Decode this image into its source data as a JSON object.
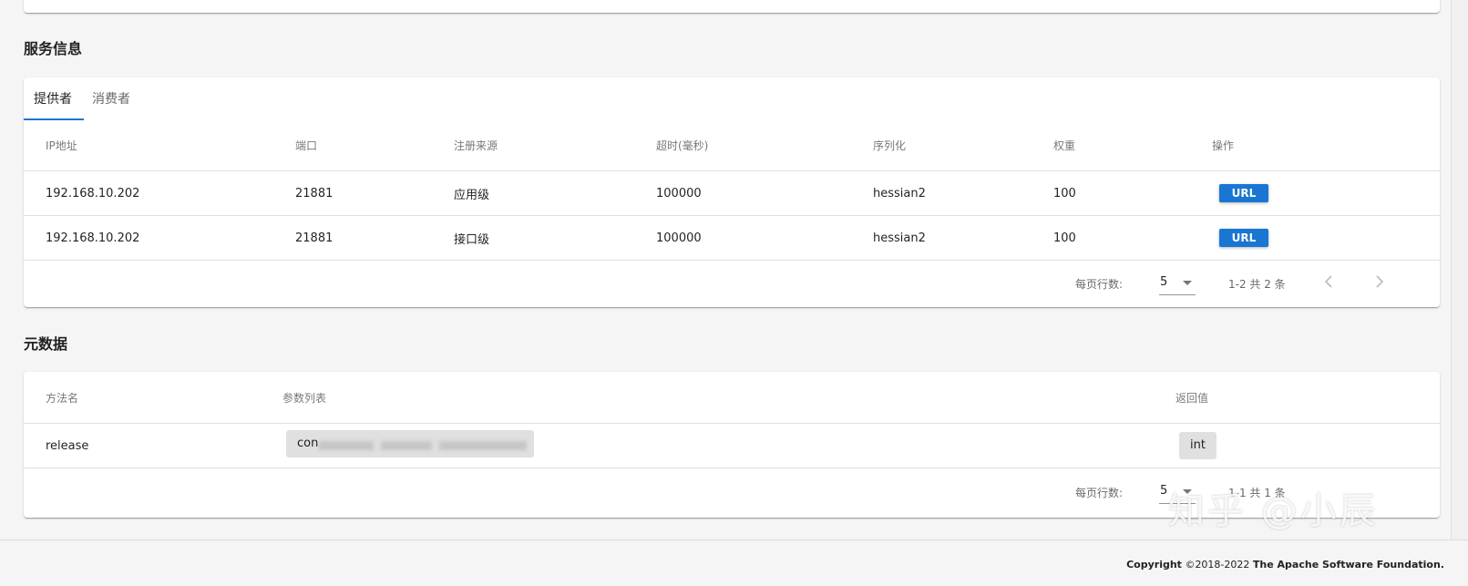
{
  "service_section": {
    "title": "服务信息",
    "tabs": [
      {
        "label": "提供者",
        "active": true
      },
      {
        "label": "消费者",
        "active": false
      }
    ],
    "columns": [
      "IP地址",
      "端口",
      "注册来源",
      "超时(毫秒)",
      "序列化",
      "权重",
      "操作"
    ],
    "rows": [
      {
        "ip": "192.168.10.202",
        "port": "21881",
        "source": "应用级",
        "timeout": "100000",
        "serialization": "hessian2",
        "weight": "100",
        "action": "URL"
      },
      {
        "ip": "192.168.10.202",
        "port": "21881",
        "source": "接口级",
        "timeout": "100000",
        "serialization": "hessian2",
        "weight": "100",
        "action": "URL"
      }
    ],
    "pagination": {
      "rows_per_page_label": "每页行数:",
      "rows_per_page": "5",
      "range": "1-2 共 2 条"
    }
  },
  "metadata_section": {
    "title": "元数据",
    "columns": [
      "方法名",
      "参数列表",
      "返回值"
    ],
    "rows": [
      {
        "method": "release",
        "params": "con",
        "return": "int"
      }
    ],
    "pagination": {
      "rows_per_page_label": "每页行数:",
      "rows_per_page": "5",
      "range": "1-1 共 1 条"
    }
  },
  "footer": {
    "copyright_label": "Copyright",
    "years": "©2018-2022",
    "org": "The Apache Software Foundation."
  },
  "watermark": "知乎 @小辰",
  "colors": {
    "accent": "#1976d2",
    "chip": "#e0e0e0",
    "background": "#f5f5f5"
  }
}
